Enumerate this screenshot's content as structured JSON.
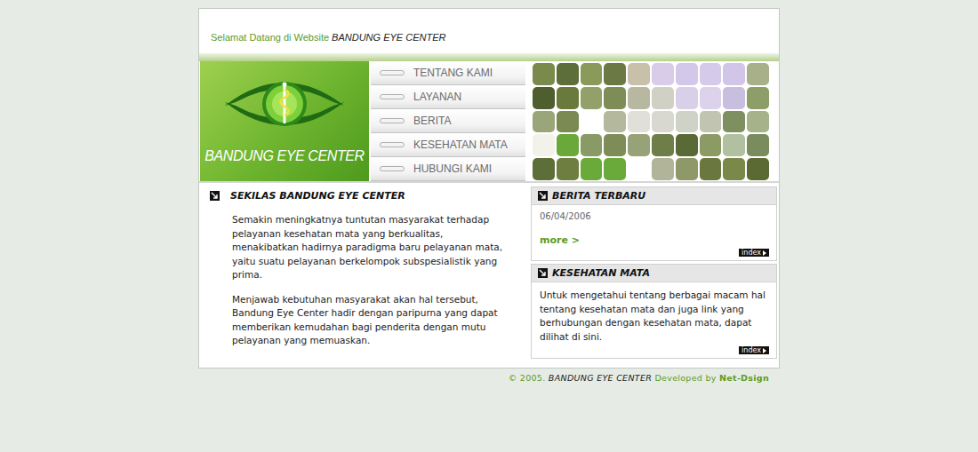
{
  "header": {
    "greeting": "Selamat Datang di Website",
    "site_name": "BANDUNG EYE CENTER"
  },
  "logo": {
    "text": "BANDUNG EYE CENTER"
  },
  "menu": [
    {
      "label": "TENTANG KAMI"
    },
    {
      "label": "LAYANAN"
    },
    {
      "label": "BERITA"
    },
    {
      "label": "KESEHATAN MATA"
    },
    {
      "label": "HUBUNGI KAMI"
    }
  ],
  "intro": {
    "title": "SEKILAS BANDUNG EYE CENTER",
    "paragraphs": [
      "Semakin meningkatnya tuntutan masyarakat terhadap pelayanan kesehatan mata yang berkualitas, menakibatkan hadirnya paradigma baru pelayanan mata, yaitu suatu pelayanan berkelompok subspesialistik yang prima.",
      "Menjawab kebutuhan masyarakat akan hal tersebut, Bandung Eye Center hadir dengan paripurna yang dapat memberikan kemudahan bagi penderita dengan mutu pelayanan yang memuaskan."
    ]
  },
  "news": {
    "title": "BERITA TERBARU",
    "date": "06/04/2006",
    "more": "more >",
    "index": "index"
  },
  "eye_health": {
    "title": "KESEHATAN MATA",
    "text": "Untuk mengetahui tentang berbagai macam hal tentang kesehatan mata dan juga link yang berhubungan dengan kesehatan mata, dapat dilihat di sini.",
    "index": "index"
  },
  "footer": {
    "copyright": "© 2005.",
    "site_name": "BANDUNG EYE CENTER",
    "developed_by": "Developed by",
    "developer": "Net-Dsign"
  }
}
